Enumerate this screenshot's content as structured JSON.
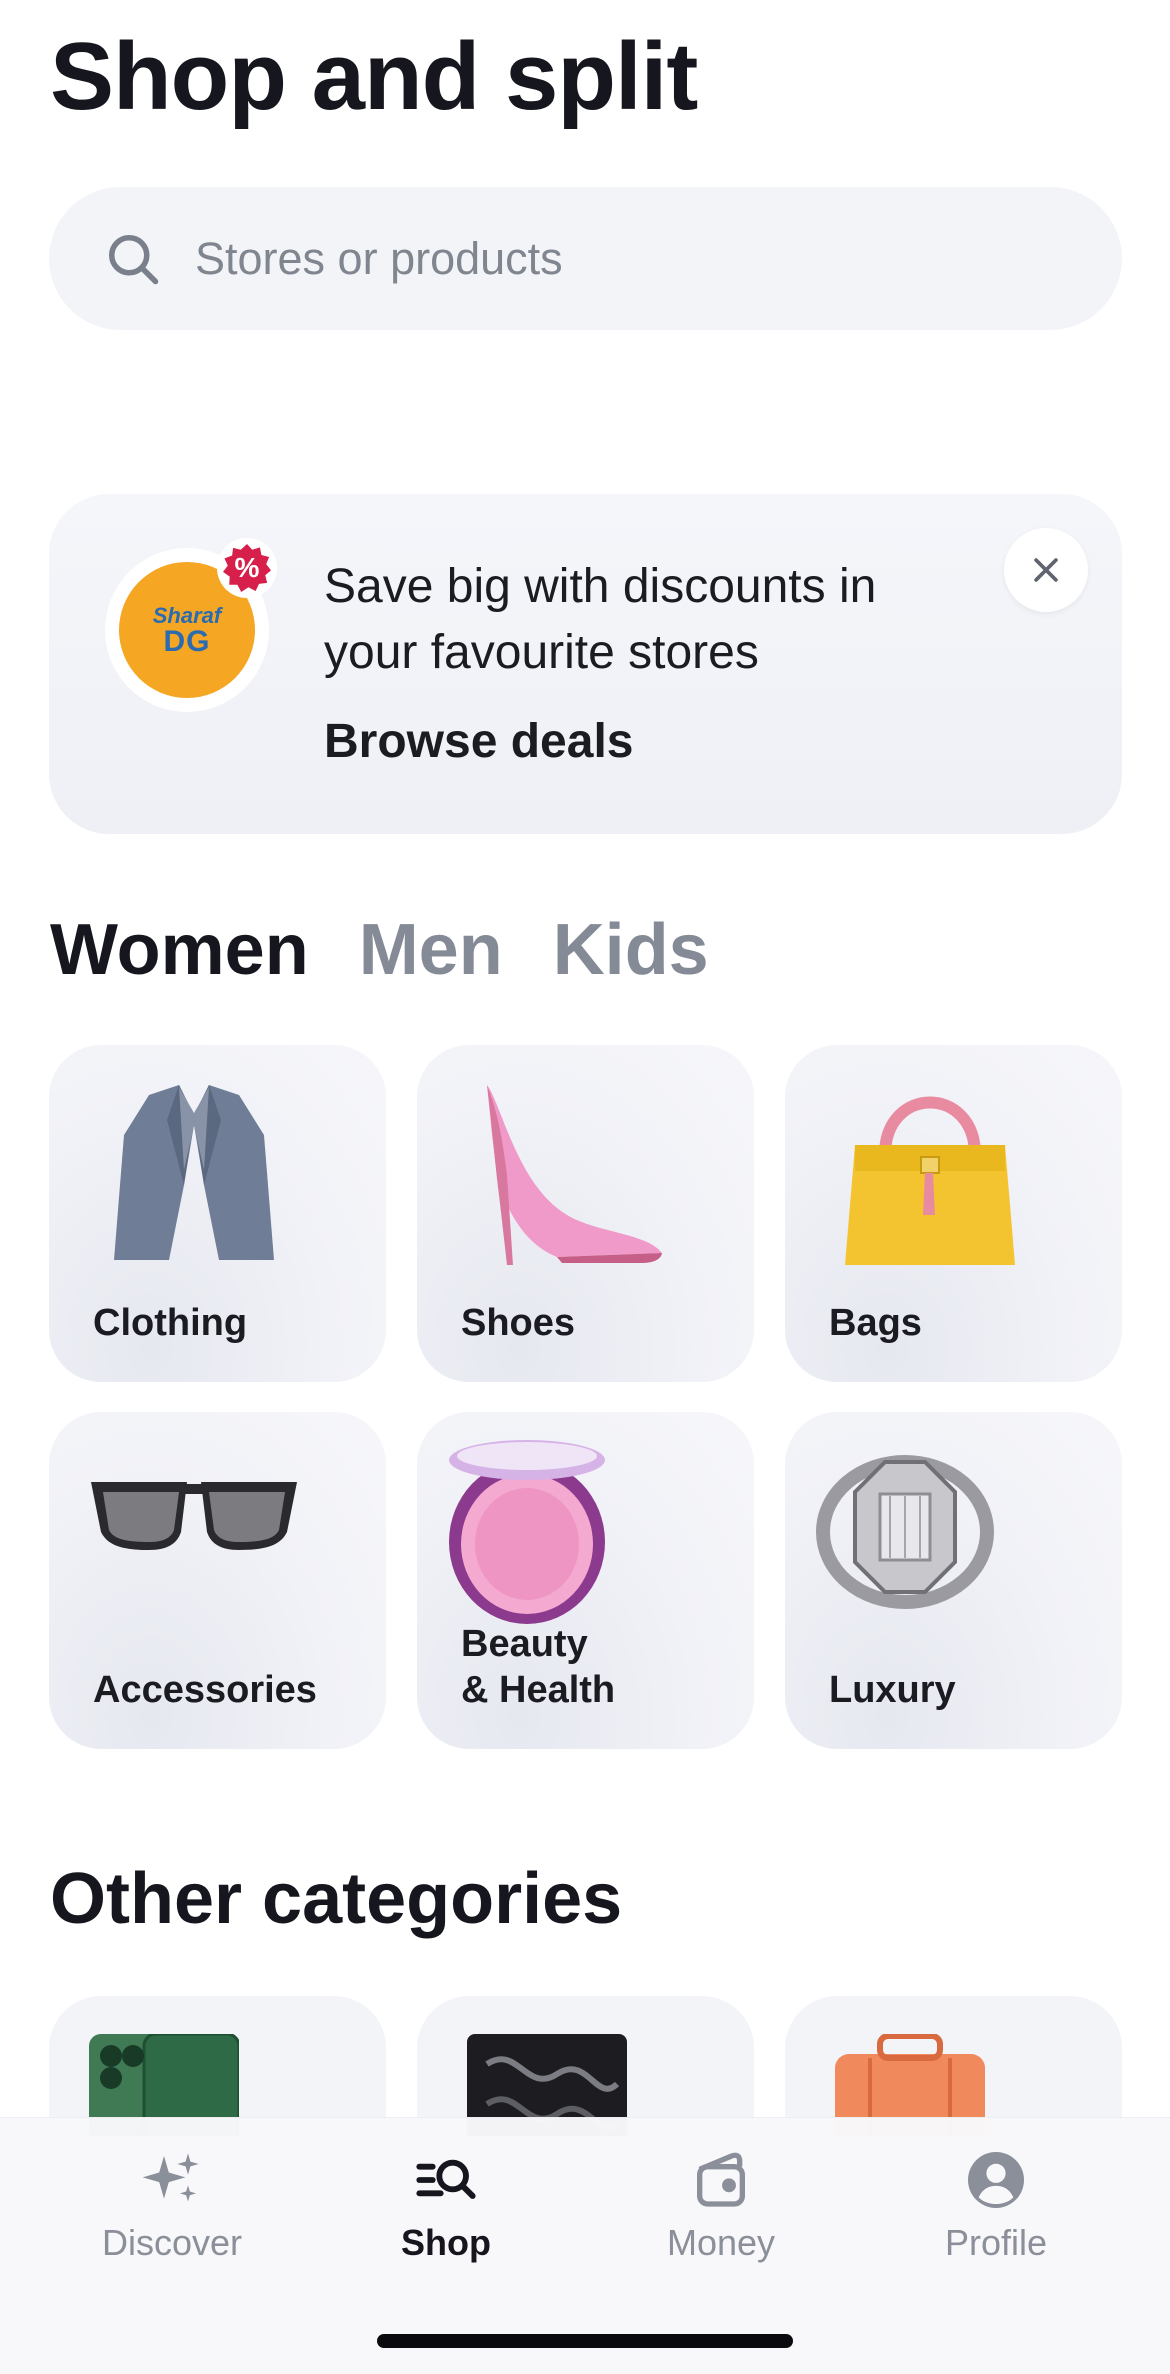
{
  "page_title": "Shop and split",
  "search": {
    "placeholder": "Stores or products",
    "icon": "search-icon"
  },
  "promo": {
    "logo_line1": "Sharaf",
    "logo_line2": "DG",
    "badge": "%",
    "text": "Save big with discounts in your favourite stores",
    "link": "Browse deals",
    "close_icon": "close-icon"
  },
  "tabs": [
    {
      "label": "Women",
      "active": true
    },
    {
      "label": "Men",
      "active": false
    },
    {
      "label": "Kids",
      "active": false
    }
  ],
  "categories": [
    {
      "label": "Clothing"
    },
    {
      "label": "Shoes"
    },
    {
      "label": "Bags"
    },
    {
      "label": "Accessories"
    },
    {
      "label": "Beauty\n& Health"
    },
    {
      "label": "Luxury"
    }
  ],
  "other_section_title": "Other categories",
  "bottom_nav": [
    {
      "label": "Discover",
      "icon": "sparkles-icon",
      "active": false
    },
    {
      "label": "Shop",
      "icon": "shop-search-icon",
      "active": true
    },
    {
      "label": "Money",
      "icon": "wallet-icon",
      "active": false
    },
    {
      "label": "Profile",
      "icon": "profile-icon",
      "active": false
    }
  ],
  "colors": {
    "text": "#16161e",
    "muted": "#858a97",
    "card_bg": "#f3f4f8",
    "badge": "#d61f4a",
    "logo_bg": "#f5a623"
  }
}
